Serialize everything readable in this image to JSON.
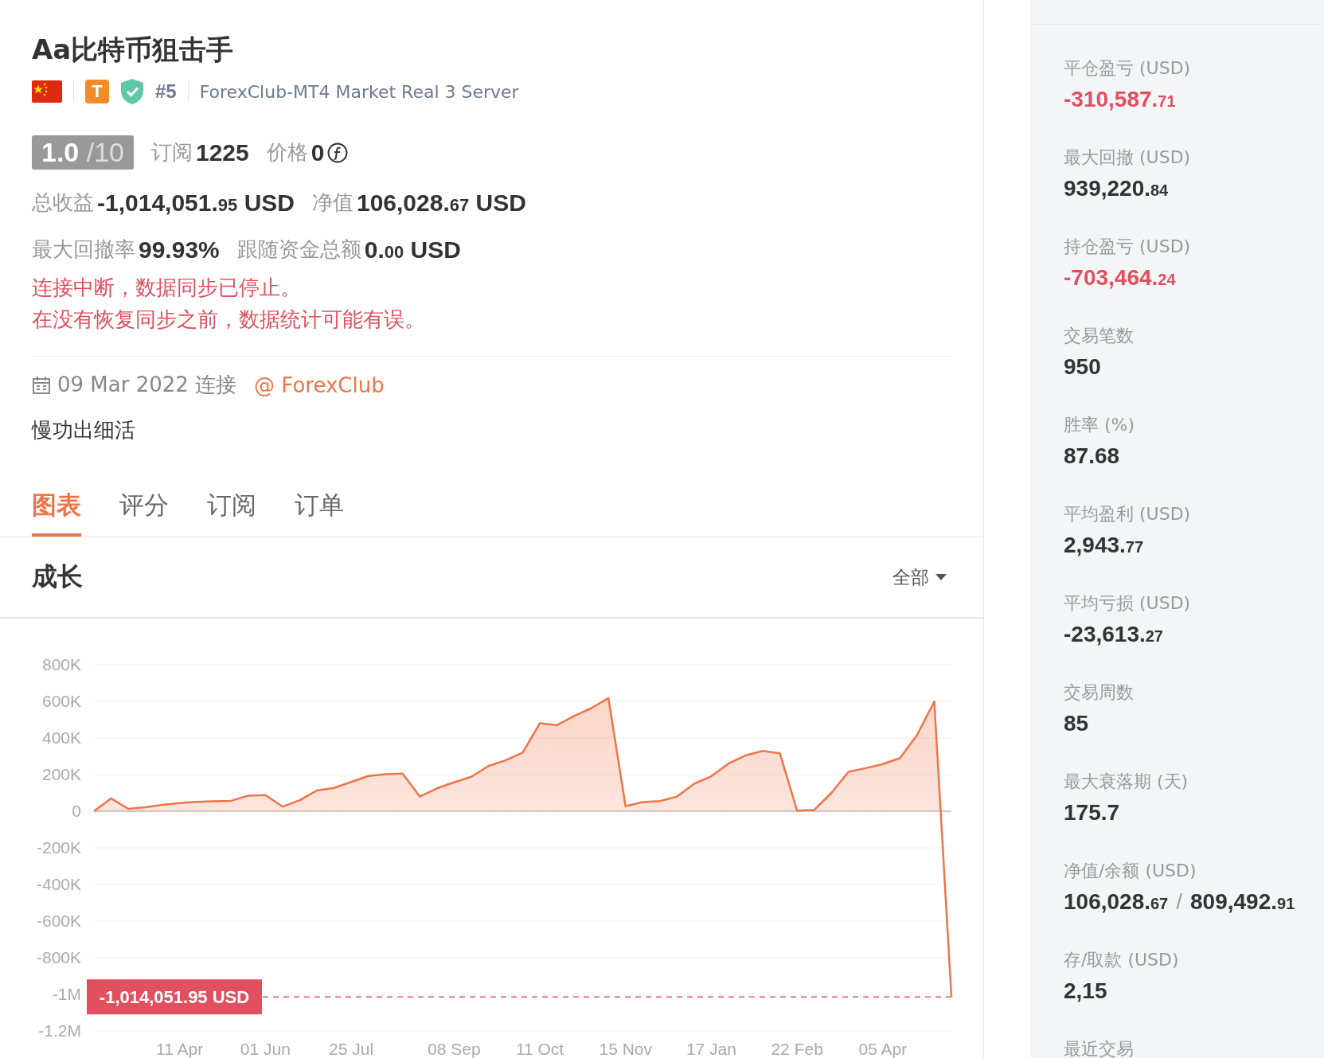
{
  "profile": {
    "title": "Aa比特币狙击手",
    "badge_letter": "T",
    "rank": "#5",
    "server": "ForexClub-MT4 Market Real 3 Server",
    "rating": {
      "score": "1.0",
      "scale": "/10"
    },
    "subscriptions": {
      "label": "订阅",
      "value": "1225"
    },
    "price": {
      "label": "价格",
      "value": "0"
    },
    "stat_rows": [
      [
        {
          "label": "总收益",
          "value": "-1,014,051.",
          "cents": "95",
          "unit": "USD"
        },
        {
          "label": "净值",
          "value": "106,028.",
          "cents": "67",
          "unit": "USD"
        }
      ],
      [
        {
          "label": "最大回撤率",
          "value": "99.93%"
        },
        {
          "label": "跟随资金总额",
          "value": "0.",
          "cents": "00",
          "unit": "USD"
        }
      ]
    ],
    "warnings": [
      "连接中断，数据同步已停止。",
      "在没有恢复同步之前，数据统计可能有误。"
    ],
    "connected": "09 Mar 2022 连接",
    "broker_link": "@ ForexClub",
    "description": "慢功出细活"
  },
  "tabs": [
    {
      "label": "图表",
      "selected": true
    },
    {
      "label": "评分",
      "selected": false
    },
    {
      "label": "订阅",
      "selected": false
    },
    {
      "label": "订单",
      "selected": false
    }
  ],
  "growth": {
    "title": "成长",
    "range": "全部",
    "chart_data": {
      "type": "area",
      "categories": [
        null,
        null,
        null,
        null,
        null,
        "11 Apr",
        null,
        null,
        null,
        null,
        "01 Jun",
        null,
        null,
        null,
        null,
        "25 Jul",
        null,
        null,
        null,
        null,
        null,
        "08 Sep",
        null,
        null,
        null,
        null,
        "11 Oct",
        null,
        null,
        null,
        null,
        "15 Nov",
        null,
        null,
        null,
        null,
        "17 Jan",
        null,
        null,
        null,
        null,
        "22 Feb",
        null,
        null,
        null,
        null,
        "05 Apr",
        null,
        null,
        null,
        null
      ],
      "series": [
        {
          "color": "#ee7449",
          "values": [
            0,
            70000,
            13000,
            22000,
            35000,
            45000,
            51000,
            54000,
            57000,
            85000,
            88000,
            25000,
            60000,
            113000,
            127000,
            160000,
            192000,
            202000,
            205000,
            80000,
            125000,
            158000,
            188000,
            247000,
            278000,
            320000,
            480000,
            470000,
            520000,
            563000,
            618000,
            27000,
            50000,
            55000,
            80000,
            150000,
            191000,
            260000,
            305000,
            329000,
            316000,
            3000,
            7000,
            100000,
            215000,
            235000,
            258000,
            290000,
            416000,
            600000,
            -1014051.95
          ]
        }
      ],
      "ylim": [
        -1200000,
        800000
      ],
      "yticks": [
        {
          "value": 800000,
          "label": "800K"
        },
        {
          "value": 600000,
          "label": "600K"
        },
        {
          "value": 400000,
          "label": "400K"
        },
        {
          "value": 200000,
          "label": "200K"
        },
        {
          "value": 0,
          "label": "0"
        },
        {
          "value": -200000,
          "label": "-200K"
        },
        {
          "value": -400000,
          "label": "-400K"
        },
        {
          "value": -600000,
          "label": "-600K"
        },
        {
          "value": -800000,
          "label": "-800K"
        },
        {
          "value": -1000000,
          "label": "-1M"
        },
        {
          "value": -1200000,
          "label": "-1.2M"
        }
      ],
      "grid": true,
      "ref_lines": [
        {
          "axis": "y",
          "value": -1014051.95,
          "color": "#e0505e"
        }
      ],
      "annotations": [
        "-1,014,051.95 USD"
      ]
    }
  },
  "stats": [
    {
      "label": "平仓盈亏 (USD)",
      "kind": "loss",
      "values": [
        {
          "value": "-310,587.",
          "cents": "71"
        }
      ]
    },
    {
      "label": "最大回撤 (USD)",
      "kind": "plain",
      "values": [
        {
          "value": "939,220.",
          "cents": "84"
        }
      ]
    },
    {
      "label": "持仓盈亏 (USD)",
      "kind": "loss",
      "values": [
        {
          "value": "-703,464.",
          "cents": "24"
        }
      ]
    },
    {
      "label": "交易笔数",
      "kind": "plain",
      "values": [
        {
          "value": "950"
        }
      ]
    },
    {
      "label": "胜率 (%)",
      "kind": "plain",
      "values": [
        {
          "value": "87.68"
        }
      ]
    },
    {
      "label": "平均盈利 (USD)",
      "kind": "plain",
      "values": [
        {
          "value": "2,943.",
          "cents": "77"
        }
      ]
    },
    {
      "label": "平均亏损 (USD)",
      "kind": "plain",
      "values": [
        {
          "value": "-23,613.",
          "cents": "27"
        }
      ]
    },
    {
      "label": "交易周数",
      "kind": "plain",
      "values": [
        {
          "value": "85"
        }
      ]
    },
    {
      "label": "最大衰落期 (天)",
      "kind": "plain",
      "values": [
        {
          "value": "175.7"
        }
      ]
    },
    {
      "label": "净值/余额 (USD)",
      "kind": "plain",
      "separator": "/",
      "values": [
        {
          "value": "106,028.",
          "cents": "67"
        },
        {
          "value": "809,492.",
          "cents": "91"
        }
      ]
    },
    {
      "label": "存/取款 (USD)",
      "kind": "plain",
      "values": [
        {
          "value": "2,15"
        }
      ]
    },
    {
      "label": "最近交易",
      "kind": "plain"
    }
  ]
}
